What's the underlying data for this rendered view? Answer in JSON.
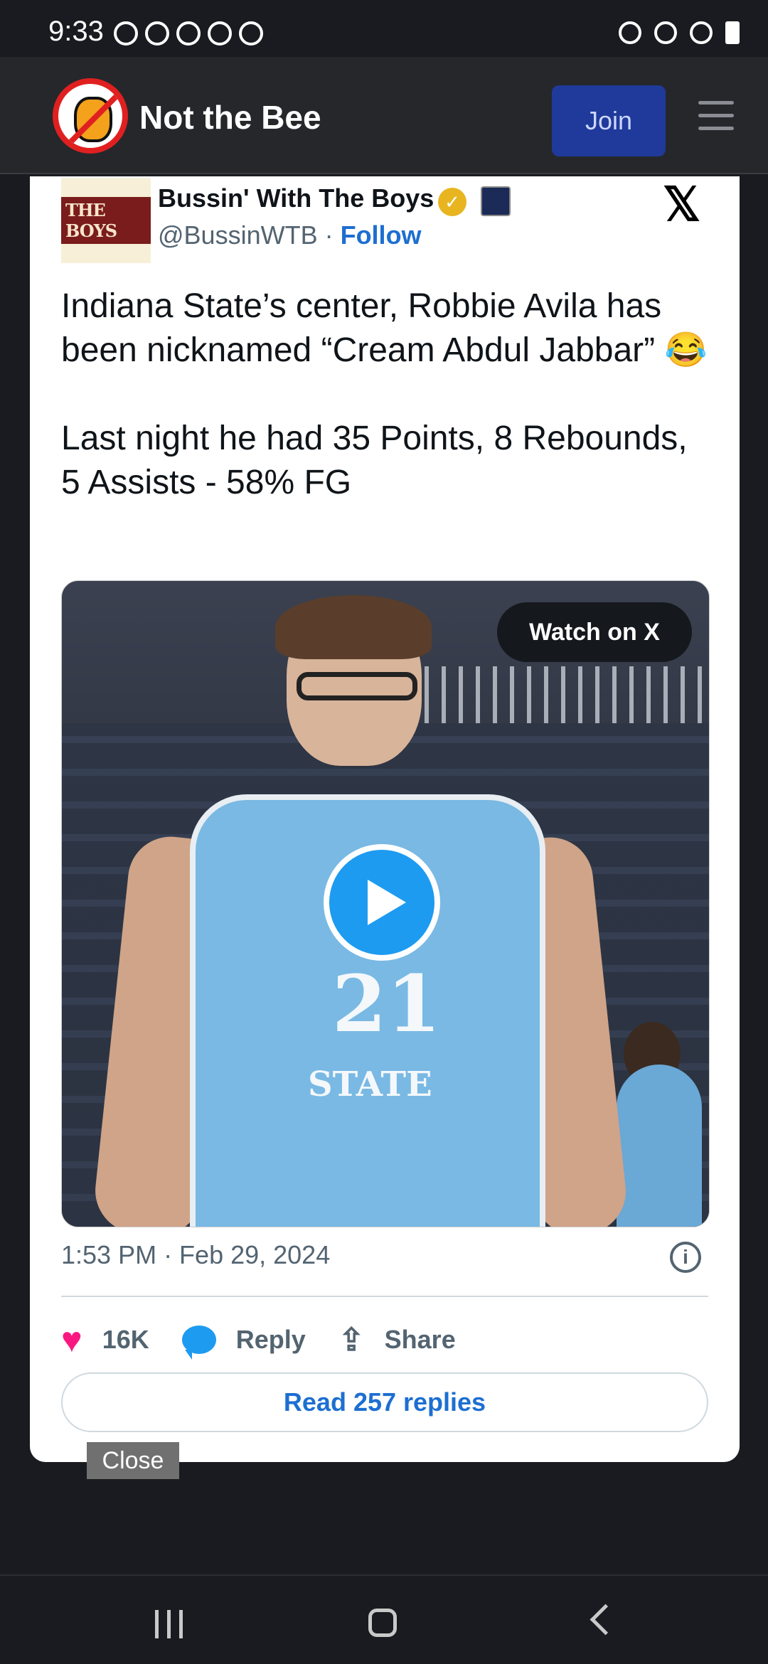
{
  "status_bar": {
    "time": "9:33"
  },
  "header": {
    "brand": "Not the Bee",
    "join_label": "Join"
  },
  "tweet": {
    "avatar_text": "THE BOYS",
    "author_name": "Bussin' With The Boys",
    "handle": "@BussinWTB",
    "separator": " · ",
    "follow_label": "Follow",
    "text": "Indiana State’s center, Robbie Avila has been nicknamed “Cream Abdul Jabbar” 😂\n\nLast night he had 35 Points, 8 Rebounds, 5 Assists  - 58% FG",
    "watch_label": "Watch on X",
    "jersey_number": "21",
    "jersey_text": "STATE",
    "timestamp": "1:53 PM · Feb 29, 2024",
    "info_icon": "i",
    "likes": "16K",
    "reply_label": "Reply",
    "share_label": "Share",
    "read_replies": "Read 257 replies"
  },
  "close_label": "Close",
  "x_logo": "𝕏"
}
